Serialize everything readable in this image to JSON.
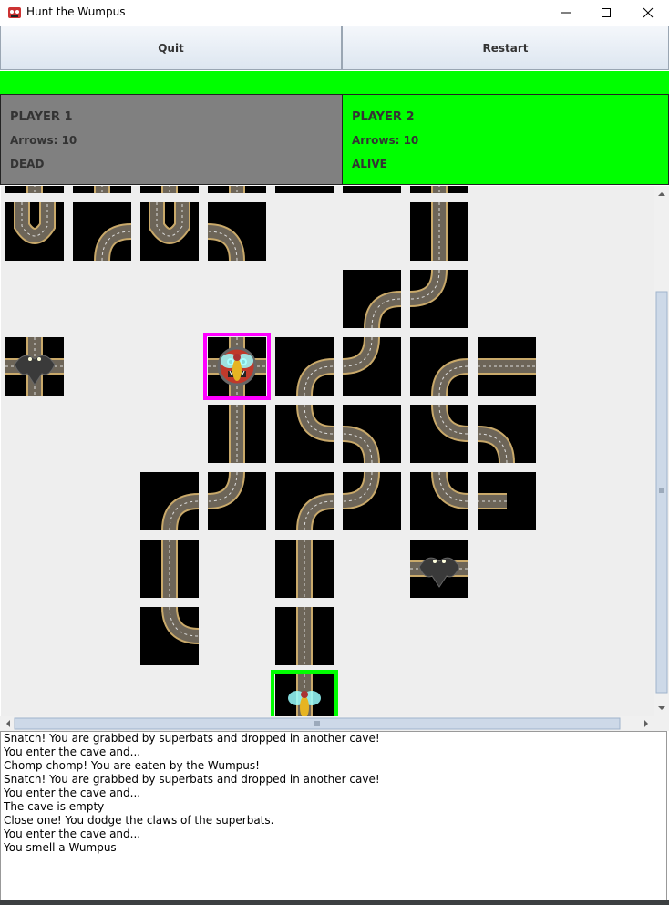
{
  "window": {
    "title": "Hunt the Wumpus"
  },
  "toolbar": {
    "quit_label": "Quit",
    "restart_label": "Restart"
  },
  "colors": {
    "alive": "#00ff00",
    "dead": "#808080",
    "player1_marker": "#ff00ff",
    "player2_marker": "#00ff00",
    "status_bar": "#00ff00"
  },
  "players": [
    {
      "name": "PLAYER 1",
      "arrows": "Arrows: 10",
      "status": "DEAD"
    },
    {
      "name": "PLAYER 2",
      "arrows": "Arrows: 10",
      "status": "ALIVE"
    }
  ],
  "log": [
    "Snatch! You are grabbed by superbats and dropped in another cave!",
    "You enter the cave and...",
    "Chomp chomp! You are eaten by the Wumpus!",
    "Snatch! You are grabbed by superbats and dropped in another cave!",
    "You enter the cave and...",
    "The cave is empty",
    "Close one! You dodge the claws of the superbats.",
    "You enter the cave and...",
    "You smell a Wumpus"
  ],
  "icons": {
    "app": "wumpus-app-icon",
    "minimize": "minimize-icon",
    "maximize": "maximize-icon",
    "close": "close-icon",
    "tunnel": "tunnel-icon",
    "bat": "superbat-icon",
    "wumpus": "wumpus-icon",
    "player": "player-icon"
  }
}
